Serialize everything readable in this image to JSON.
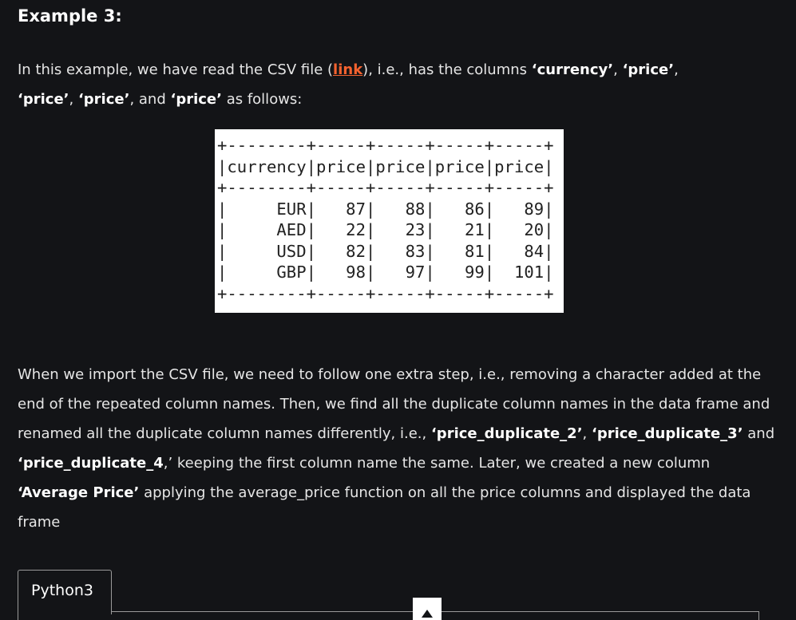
{
  "article": {
    "heading": "Example 3:",
    "intro": {
      "t1": "In this example, we have read the CSV file (",
      "link": "link",
      "t2": "), i.e., has the columns ",
      "b1": "‘currency’",
      "t3": ", ",
      "b2": "‘price’",
      "t4": ",",
      "b3": "‘price’",
      "t5": ", ",
      "b4": "‘price’",
      "t6": ", and ",
      "b5": "‘price’",
      "t7": " as follows:"
    },
    "csv_table": "+--------+-----+-----+-----+-----+\n|currency|price|price|price|price|\n+--------+-----+-----+-----+-----+\n|     EUR|   87|   88|   86|   89|\n|     AED|   22|   23|   21|   20|\n|     USD|   82|   83|   81|   84|\n|     GBP|   98|   97|   99|  101|\n+--------+-----+-----+-----+-----+",
    "explanation": {
      "t1": "When we import the CSV file, we need to follow one extra step, i.e., removing a character added at the end of the repeated column names. Then, we find all the duplicate column names in the data frame and renamed all the duplicate column names differently, i.e., ",
      "b1": "‘price_duplicate_2’",
      "t2": ", ",
      "b2": "‘price_duplicate_3’",
      "t3": " and ",
      "b3": "‘price_duplicate_4",
      "t4": ",’ keeping the first column name the same. Later, we created a new column ",
      "b4": "‘Average Price’",
      "t5": " applying the average_price function on all the price columns and displayed the data frame"
    }
  },
  "code_block": {
    "tab_label": "Python3"
  },
  "icons": {
    "scroll_up": "triangle-up-icon"
  },
  "colors": {
    "background": "#131417",
    "link": "#f4622f",
    "text": "#e6e6e6"
  }
}
